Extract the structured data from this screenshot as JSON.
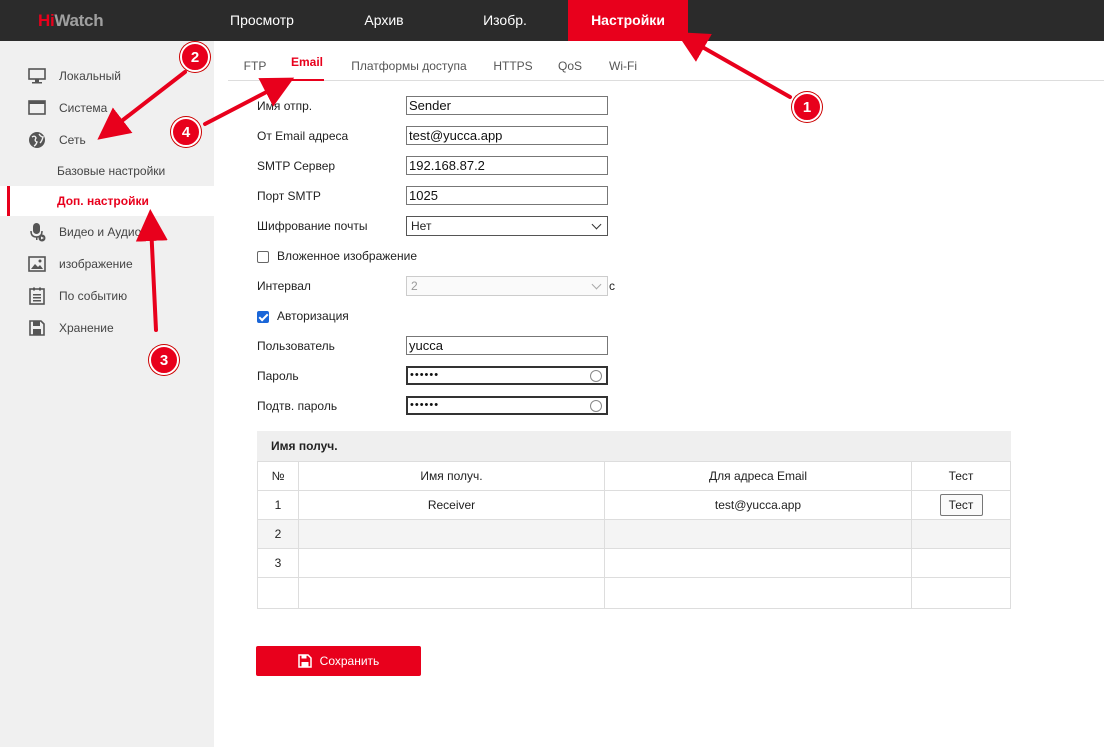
{
  "brand": {
    "name_a": "Hi",
    "name_b": "Watch",
    "color": "#e8001c"
  },
  "nav": [
    {
      "label": "Просмотр",
      "active": false
    },
    {
      "label": "Архив",
      "active": false
    },
    {
      "label": "Изобр.",
      "active": false
    },
    {
      "label": "Настройки",
      "active": true
    }
  ],
  "sidebar": {
    "items": [
      {
        "label": "Локальный",
        "icon": "monitor-icon"
      },
      {
        "label": "Система",
        "icon": "window-icon"
      },
      {
        "label": "Сеть",
        "icon": "globe-icon"
      },
      {
        "label": "Базовые настройки",
        "sub": true
      },
      {
        "label": "Доп. настройки",
        "sub": true,
        "active": true
      },
      {
        "label": "Видео и Аудио",
        "icon": "microphone-icon"
      },
      {
        "label": "изображение",
        "icon": "image-icon"
      },
      {
        "label": "По событию",
        "icon": "list-icon"
      },
      {
        "label": "Хранение",
        "icon": "floppy-icon"
      }
    ]
  },
  "tabs": [
    {
      "label": "FTP"
    },
    {
      "label": "Email",
      "active": true
    },
    {
      "label": "Платформы доступа"
    },
    {
      "label": "HTTPS"
    },
    {
      "label": "QoS"
    },
    {
      "label": "Wi-Fi"
    }
  ],
  "form": {
    "sender_label": "Имя отпр.",
    "sender_value": "Sender",
    "from_label": "От Email адреса",
    "from_value": "test@yucca.app",
    "smtp_label": "SMTP Сервер",
    "smtp_value": "192.168.87.2",
    "port_label": "Порт SMTP",
    "port_value": "1025",
    "encryption_label": "Шифрование почты",
    "encryption_value": "Нет",
    "attach_label": "Вложенное изображение",
    "attach_checked": false,
    "interval_label": "Интервал",
    "interval_value": "2",
    "interval_unit": "с",
    "auth_label": "Авторизация",
    "auth_checked": true,
    "user_label": "Пользователь",
    "user_value": "yucca",
    "password_label": "Пароль",
    "password_value": "••••••",
    "confirm_label": "Подтв. пароль",
    "confirm_value": "••••••"
  },
  "recipients": {
    "title": "Имя получ.",
    "columns": [
      "№",
      "Имя получ.",
      "Для адреса Email",
      "Тест"
    ],
    "rows": [
      {
        "no": "1",
        "name": "Receiver",
        "email": "test@yucca.app",
        "test": "Тест"
      },
      {
        "no": "2",
        "name": "",
        "email": "",
        "test": ""
      },
      {
        "no": "3",
        "name": "",
        "email": "",
        "test": ""
      }
    ]
  },
  "save_label": "Сохранить",
  "annotations": [
    "1",
    "2",
    "3",
    "4"
  ]
}
